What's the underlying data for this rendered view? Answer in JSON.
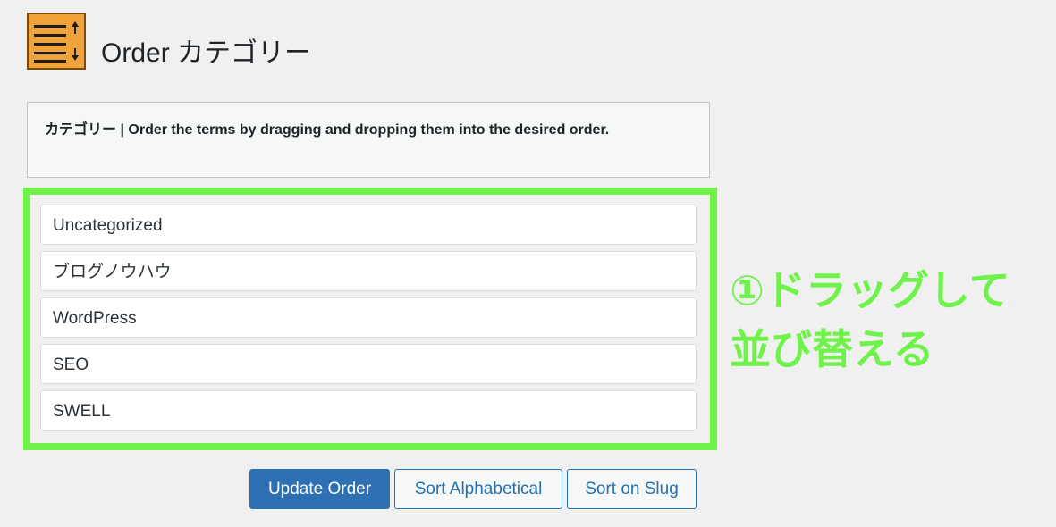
{
  "header": {
    "icon": "reorder-list-icon",
    "title": "Order カテゴリー"
  },
  "description": {
    "taxonomy": "カテゴリー",
    "separator": "|",
    "text": "Order the terms by dragging and dropping them into the desired order."
  },
  "terms": [
    {
      "label": "Uncategorized"
    },
    {
      "label": "ブログノウハウ"
    },
    {
      "label": "WordPress"
    },
    {
      "label": "SEO"
    },
    {
      "label": "SWELL"
    }
  ],
  "annotation": {
    "line1": "①ドラッグして",
    "line2": "並び替える",
    "color": "#6ff34a"
  },
  "buttons": {
    "update": "Update Order",
    "alphabetical": "Sort Alphabetical",
    "slug": "Sort on Slug"
  },
  "colors": {
    "primary": "#2d70b3",
    "highlight": "#6ff34a",
    "icon_bg": "#f0a33a"
  }
}
